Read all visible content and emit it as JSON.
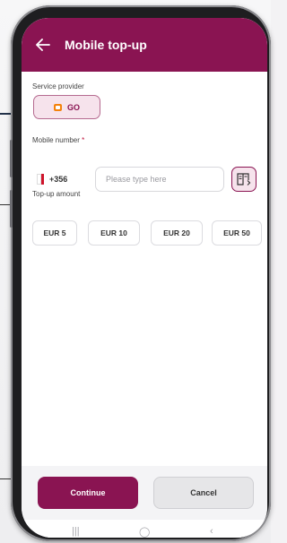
{
  "header": {
    "title": "Mobile top-up"
  },
  "service_provider": {
    "label": "Service provider",
    "selected": "GO"
  },
  "mobile_number": {
    "label": "Mobile number",
    "required_mark": "*",
    "country_code": "+356",
    "placeholder": "Please type here",
    "value": ""
  },
  "topup": {
    "label": "Top-up amount",
    "options": [
      "EUR 5",
      "EUR 10",
      "EUR 20",
      "EUR 50"
    ]
  },
  "actions": {
    "continue_label": "Continue",
    "cancel_label": "Cancel"
  },
  "navbar": {
    "recent_glyph": "|||",
    "home_glyph": "◯",
    "back_glyph": "‹"
  },
  "colors": {
    "accent": "#8a1452",
    "accent_light": "#f6e3ec",
    "go_orange": "#f4820c"
  }
}
